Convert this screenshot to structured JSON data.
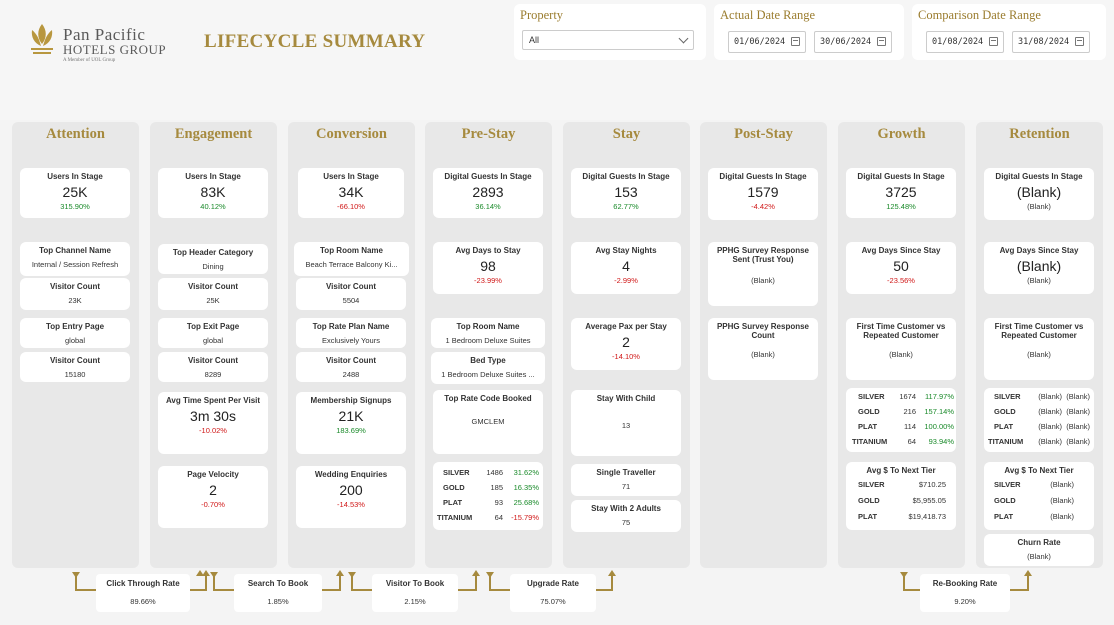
{
  "header": {
    "brand_line1": "Pan Pacific",
    "brand_line2": "HOTELS GROUP",
    "brand_line3": "A Member of UOL Group",
    "title": "LIFECYCLE SUMMARY"
  },
  "filters": {
    "property_label": "Property",
    "property_value": "All",
    "actual_label": "Actual Date Range",
    "actual_start": "01/06/2024",
    "actual_end": "30/06/2024",
    "comparison_label": "Comparison Date Range",
    "comparison_start": "01/08/2024",
    "comparison_end": "31/08/2024"
  },
  "columns": {
    "attention": {
      "title": "Attention",
      "users_label": "Users In Stage",
      "users_value": "25K",
      "users_pct": "315.90%",
      "channel_label": "Top Channel Name",
      "channel_value": "Internal / Session Refresh",
      "visitor1_label": "Visitor Count",
      "visitor1_value": "23K",
      "entry_label": "Top Entry Page",
      "entry_value": "global",
      "visitor2_label": "Visitor Count",
      "visitor2_value": "15180"
    },
    "engagement": {
      "title": "Engagement",
      "users_label": "Users In Stage",
      "users_value": "83K",
      "users_pct": "40.12%",
      "header_label": "Top Header Category",
      "header_value": "Dining",
      "visitor1_label": "Visitor Count",
      "visitor1_value": "25K",
      "exit_label": "Top Exit Page",
      "exit_value": "global",
      "visitor2_label": "Visitor Count",
      "visitor2_value": "8289",
      "time_label": "Avg Time Spent Per Visit",
      "time_value": "3m 30s",
      "time_pct": "-10.02%",
      "velocity_label": "Page Velocity",
      "velocity_value": "2",
      "velocity_pct": "-0.70%"
    },
    "conversion": {
      "title": "Conversion",
      "users_label": "Users In Stage",
      "users_value": "34K",
      "users_pct": "-66.10%",
      "room_label": "Top Room Name",
      "room_value": "Beach Terrace Balcony Ki...",
      "visitor1_label": "Visitor Count",
      "visitor1_value": "5504",
      "rate_label": "Top Rate Plan Name",
      "rate_value": "Exclusively Yours",
      "visitor2_label": "Visitor Count",
      "visitor2_value": "2488",
      "membership_label": "Membership Signups",
      "membership_value": "21K",
      "membership_pct": "183.69%",
      "wedding_label": "Wedding Enquiries",
      "wedding_value": "200",
      "wedding_pct": "-14.53%"
    },
    "prestay": {
      "title": "Pre-Stay",
      "users_label": "Digital Guests In Stage",
      "users_value": "2893",
      "users_pct": "36.14%",
      "days_label": "Avg Days to Stay",
      "days_value": "98",
      "days_pct": "-23.99%",
      "room_label": "Top Room Name",
      "room_value": "1 Bedroom Deluxe Suites",
      "bed_label": "Bed Type",
      "bed_value": "1 Bedroom Deluxe Suites ...",
      "ratecode_label": "Top Rate Code Booked",
      "ratecode_value": "GMCLEM",
      "tiers": [
        {
          "name": "SILVER",
          "count": "1486",
          "pct": "31.62%"
        },
        {
          "name": "GOLD",
          "count": "185",
          "pct": "16.35%"
        },
        {
          "name": "PLAT",
          "count": "93",
          "pct": "25.68%"
        },
        {
          "name": "TITANIUM",
          "count": "64",
          "pct": "-15.79%"
        }
      ]
    },
    "stay": {
      "title": "Stay",
      "users_label": "Digital Guests In Stage",
      "users_value": "153",
      "users_pct": "62.77%",
      "nights_label": "Avg Stay Nights",
      "nights_value": "4",
      "nights_pct": "-2.99%",
      "pax_label": "Average Pax per Stay",
      "pax_value": "2",
      "pax_pct": "-14.10%",
      "child_label": "Stay With Child",
      "child_value": "13",
      "single_label": "Single Traveller",
      "single_value": "71",
      "adults_label": "Stay With 2 Adults",
      "adults_value": "75"
    },
    "poststay": {
      "title": "Post-Stay",
      "users_label": "Digital Guests In Stage",
      "users_value": "1579",
      "users_pct": "-4.42%",
      "survey_sent_label": "PPHG Survey Response Sent (Trust You)",
      "survey_sent_value": "(Blank)",
      "survey_count_label": "PPHG Survey Response Count",
      "survey_count_value": "(Blank)"
    },
    "growth": {
      "title": "Growth",
      "users_label": "Digital Guests In Stage",
      "users_value": "3725",
      "users_pct": "125.48%",
      "days_label": "Avg Days Since Stay",
      "days_value": "50",
      "days_pct": "-23.56%",
      "first_label": "First Time Customer vs Repeated Customer",
      "first_value": "(Blank)",
      "tiers": [
        {
          "name": "SILVER",
          "count": "1674",
          "pct": "117.97%"
        },
        {
          "name": "GOLD",
          "count": "216",
          "pct": "157.14%"
        },
        {
          "name": "PLAT",
          "count": "114",
          "pct": "100.00%"
        },
        {
          "name": "TITANIUM",
          "count": "64",
          "pct": "93.94%"
        }
      ],
      "next_tier_label": "Avg $ To Next Tier",
      "next_tiers": [
        {
          "name": "SILVER",
          "value": "$710.25"
        },
        {
          "name": "GOLD",
          "value": "$5,955.05"
        },
        {
          "name": "PLAT",
          "value": "$19,418.73"
        }
      ]
    },
    "retention": {
      "title": "Retention",
      "users_label": "Digital Guests In Stage",
      "users_value": "(Blank)",
      "users_sub": "(Blank)",
      "days_label": "Avg Days Since Stay",
      "days_value": "(Blank)",
      "days_sub": "(Blank)",
      "first_label": "First Time Customer vs Repeated Customer",
      "first_value": "(Blank)",
      "tiers": [
        {
          "name": "SILVER",
          "count": "(Blank)",
          "pct": "(Blank)"
        },
        {
          "name": "GOLD",
          "count": "(Blank)",
          "pct": "(Blank)"
        },
        {
          "name": "PLAT",
          "count": "(Blank)",
          "pct": "(Blank)"
        },
        {
          "name": "TITANIUM",
          "count": "(Blank)",
          "pct": "(Blank)"
        }
      ],
      "next_tier_label": "Avg $ To Next Tier",
      "next_tiers": [
        {
          "name": "SILVER",
          "value": "(Blank)"
        },
        {
          "name": "GOLD",
          "value": "(Blank)"
        },
        {
          "name": "PLAT",
          "value": "(Blank)"
        }
      ],
      "churn_label": "Churn Rate",
      "churn_value": "(Blank)"
    }
  },
  "rates": {
    "click_label": "Click Through Rate",
    "click_value": "89.66%",
    "search_label": "Search To Book",
    "search_value": "1.85%",
    "visitor_label": "Visitor To Book",
    "visitor_value": "2.15%",
    "upgrade_label": "Upgrade Rate",
    "upgrade_value": "75.07%",
    "rebook_label": "Re-Booking Rate",
    "rebook_value": "9.20%"
  },
  "colors": {
    "gold": "#a68a3e",
    "positive": "#1a8a2a",
    "negative": "#d01818"
  }
}
